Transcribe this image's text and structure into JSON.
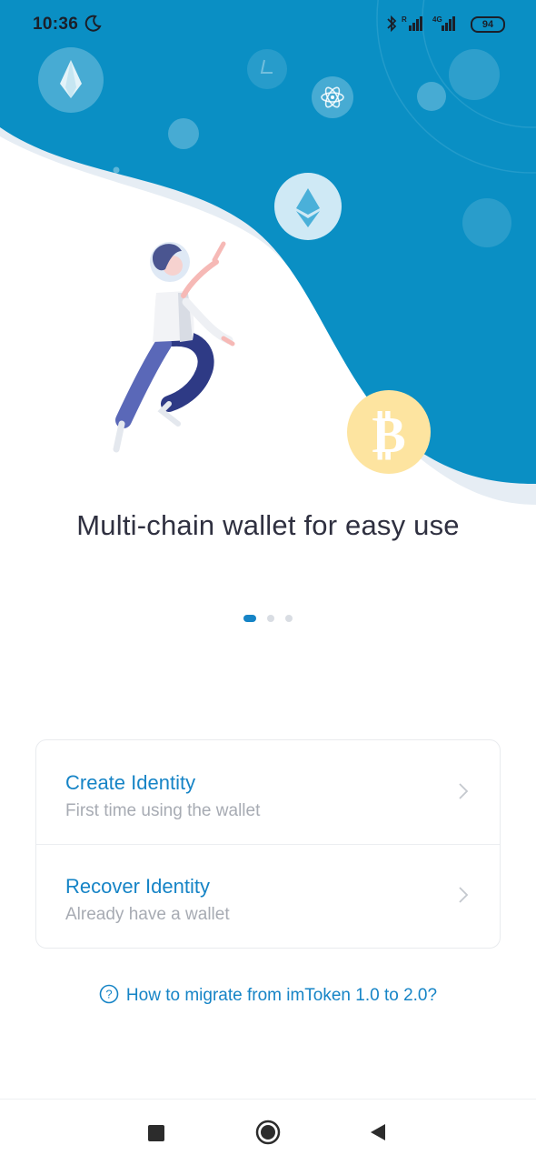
{
  "status_bar": {
    "time": "10:36",
    "battery": "94",
    "network_label": "4G",
    "icons": [
      "moon-icon",
      "bluetooth-icon",
      "signal-icon",
      "signal-4g-icon",
      "battery-icon"
    ]
  },
  "hero": {
    "colors": {
      "wave": "#0a8fc4",
      "wave_shadow": "#e6edf4",
      "bitcoin": "#fde4a0"
    },
    "coin_icons": [
      "eos-icon",
      "ethereum-icon",
      "atom-icon",
      "litecoin-icon",
      "bitcoin-icon"
    ]
  },
  "onboarding": {
    "headline": "Multi-chain wallet for easy use",
    "page_indicator": {
      "current": 1,
      "total": 3
    }
  },
  "actions": {
    "create": {
      "title": "Create Identity",
      "subtitle": "First time using the wallet"
    },
    "recover": {
      "title": "Recover Identity",
      "subtitle": "Already have a wallet"
    }
  },
  "help": {
    "label": "How to migrate from imToken 1.0 to 2.0?"
  },
  "nav": {
    "icons": [
      "recents-square-icon",
      "home-circle-icon",
      "back-triangle-icon"
    ]
  },
  "colors": {
    "accent": "#1684c6",
    "text": "#2f3040",
    "subtle": "#a7abb3"
  }
}
